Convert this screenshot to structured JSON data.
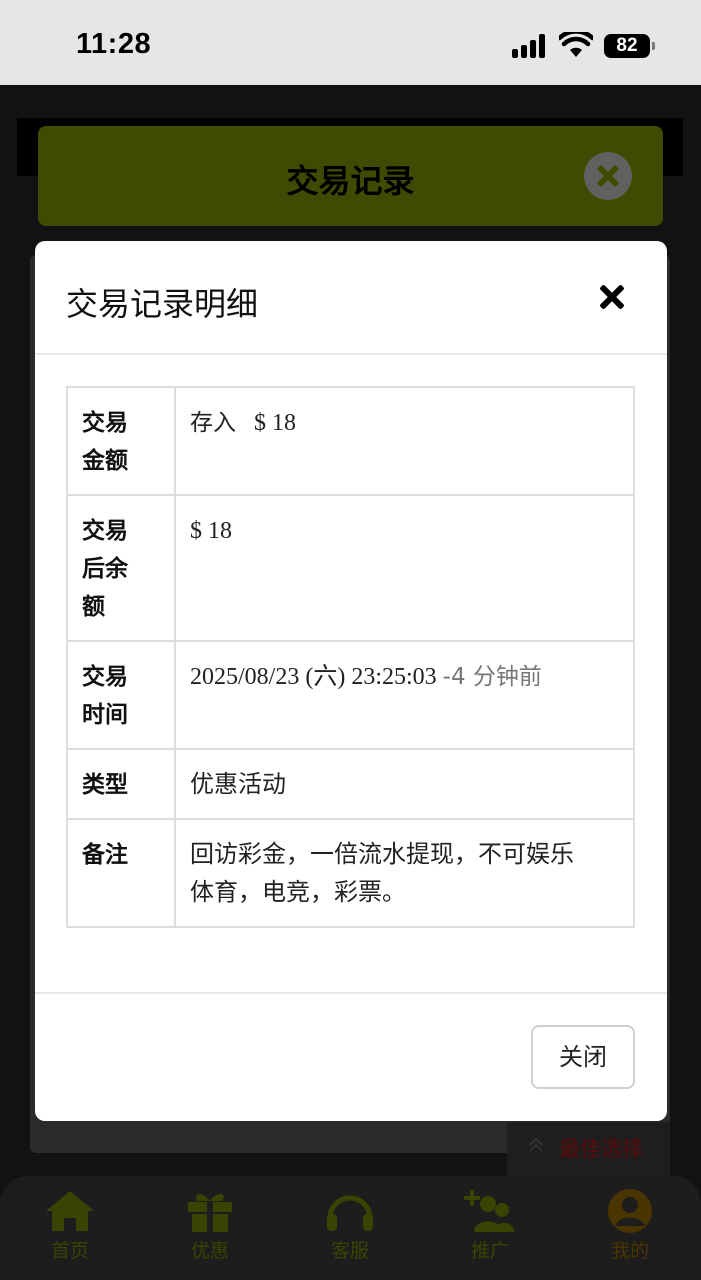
{
  "status_bar": {
    "time": "11:28",
    "battery": "82"
  },
  "page": {
    "title": "交易记录"
  },
  "modal": {
    "title": "交易记录明细",
    "rows": [
      {
        "label": "交易金额",
        "label_lines": [
          "交易",
          "金额"
        ],
        "direction": "存入",
        "amount": "$ 18"
      },
      {
        "label": "交易后余额",
        "label_lines": [
          "交易",
          "后余",
          "额"
        ],
        "value": "$ 18"
      },
      {
        "label": "交易时间",
        "label_lines": [
          "交易",
          "时间"
        ],
        "datetime": "2025/08/23 (六) 23:25:03",
        "relative": "-4 分钟前"
      },
      {
        "label": "类型",
        "value": "优惠活动"
      },
      {
        "label": "备注",
        "value_lines": [
          "回访彩金，一倍流水提现，不可娱乐",
          "体育，电竞，彩票。"
        ]
      }
    ],
    "close_button": "关闭"
  },
  "floating": {
    "best_choice": "最佳选择"
  },
  "bottom_nav": [
    {
      "label": "首页",
      "icon": "home-icon"
    },
    {
      "label": "优惠",
      "icon": "gift-icon"
    },
    {
      "label": "客服",
      "icon": "headset-icon"
    },
    {
      "label": "推广",
      "icon": "add-user-icon"
    },
    {
      "label": "我的",
      "icon": "user-circle-icon"
    }
  ],
  "colors": {
    "accent_dark": "#3f4a02",
    "positive": "#3c7d3c",
    "muted": "#777777"
  }
}
